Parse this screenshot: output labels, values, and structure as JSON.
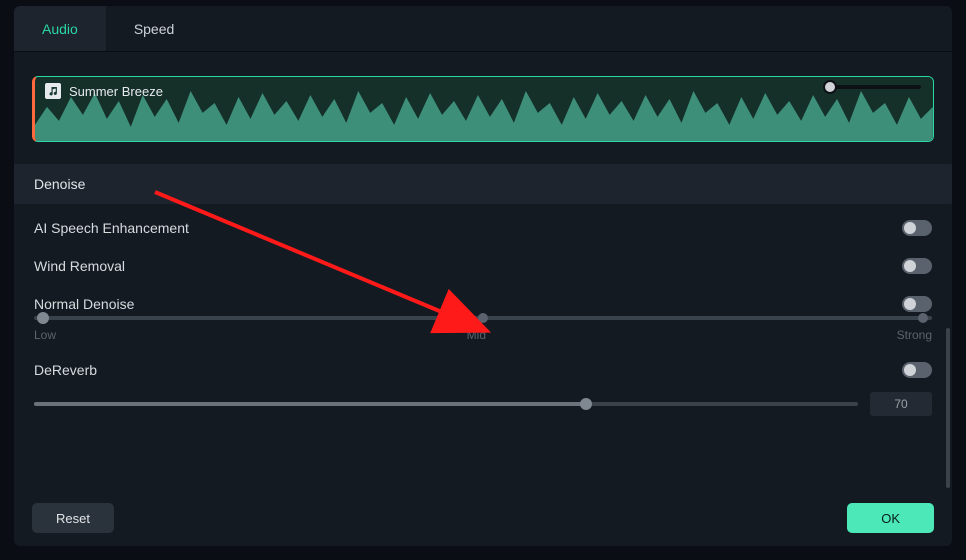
{
  "tabs": {
    "audio": "Audio",
    "speed": "Speed"
  },
  "waveform": {
    "title": "Summer Breeze"
  },
  "section": {
    "denoise": "Denoise"
  },
  "rows": {
    "ai_speech": {
      "label": "AI Speech Enhancement",
      "on": false
    },
    "wind": {
      "label": "Wind Removal",
      "on": false
    },
    "normal": {
      "label": "Normal Denoise",
      "on": false
    },
    "dereverb": {
      "label": "DeReverb",
      "on": false
    }
  },
  "normal_slider": {
    "value": 0,
    "labels": {
      "low": "Low",
      "mid": "Mid",
      "strong": "Strong"
    }
  },
  "dereverb_slider": {
    "value": 70
  },
  "footer": {
    "reset": "Reset",
    "ok": "OK"
  },
  "colors": {
    "accent": "#2ad6a3",
    "ok_button": "#4de8b8",
    "wave_fill": "#3e8f7a",
    "wave_bg": "#1a3a34",
    "arrow": "#ff1a1a"
  }
}
